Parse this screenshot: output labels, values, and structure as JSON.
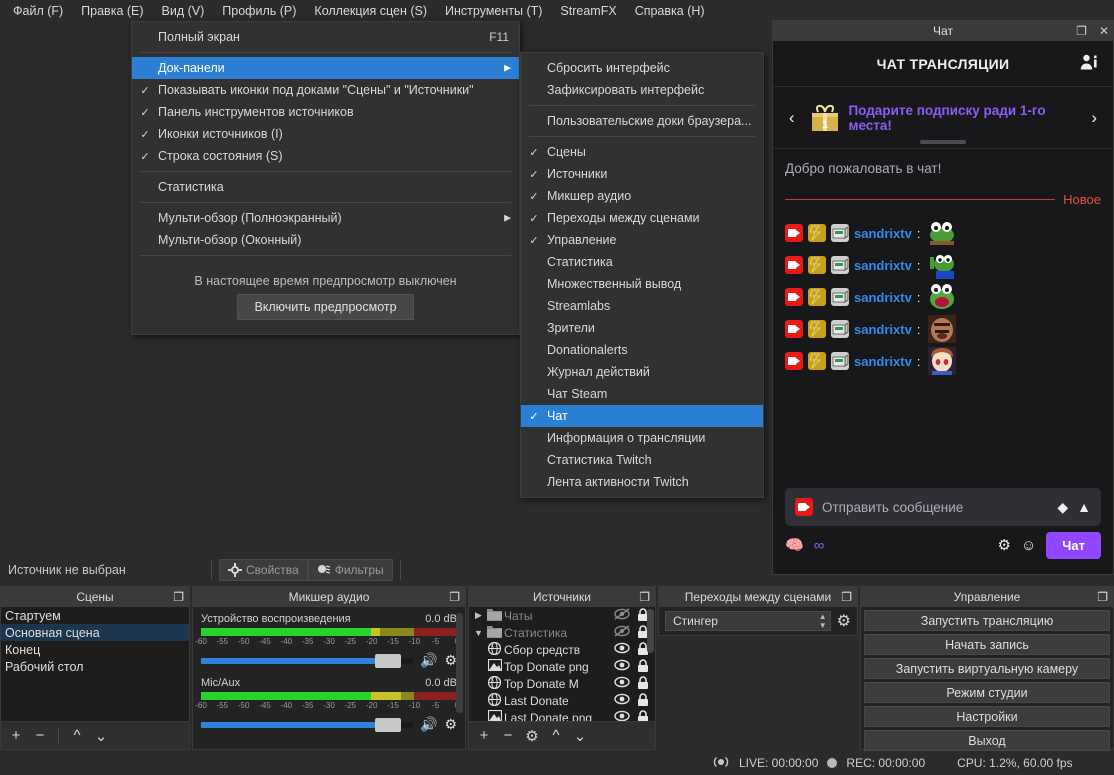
{
  "app": {
    "menubar": [
      {
        "label": "Файл (F)"
      },
      {
        "label": "Правка (E)"
      },
      {
        "label": "Вид (V)"
      },
      {
        "label": "Профиль (P)"
      },
      {
        "label": "Коллекция сцен (S)"
      },
      {
        "label": "Инструменты (T)"
      },
      {
        "label": "StreamFX"
      },
      {
        "label": "Справка (H)"
      }
    ]
  },
  "view_menu": {
    "fullscreen": {
      "label": "Полный экран",
      "shortcut": "F11"
    },
    "docks": {
      "label": "Док-панели",
      "selected": true,
      "has_submenu": true
    },
    "show_icons": {
      "label": "Показывать иконки под доками \"Сцены\" и \"Источники\"",
      "checked": true
    },
    "source_toolbar": {
      "label": "Панель инструментов источников",
      "checked": true
    },
    "source_icons": {
      "label": "Иконки источников (I)",
      "checked": true
    },
    "status_bar": {
      "label": "Строка состояния (S)",
      "checked": true
    },
    "stats": {
      "label": "Статистика"
    },
    "multiview_fullscreen": {
      "label": "Мульти-обзор (Полноэкранный)",
      "has_submenu": true
    },
    "multiview_windowed": {
      "label": "Мульти-обзор (Оконный)"
    },
    "preview_off_text": "В настоящее время предпросмотр выключен",
    "enable_preview_button": "Включить предпросмотр"
  },
  "dock_menu": {
    "items": [
      {
        "label": "Сбросить интерфейс",
        "checked": false
      },
      {
        "label": "Зафиксировать интерфейс",
        "checked": false
      },
      {
        "sep": true
      },
      {
        "label": "Пользовательские доки браузера...",
        "checked": false
      },
      {
        "sep": true
      },
      {
        "label": "Сцены",
        "checked": true
      },
      {
        "label": "Источники",
        "checked": true
      },
      {
        "label": "Микшер аудио",
        "checked": true
      },
      {
        "label": "Переходы между сценами",
        "checked": true
      },
      {
        "label": "Управление",
        "checked": true
      },
      {
        "label": "Статистика",
        "checked": false
      },
      {
        "label": "Множественный вывод",
        "checked": false
      },
      {
        "label": "Streamlabs",
        "checked": false
      },
      {
        "label": "Зрители",
        "checked": false
      },
      {
        "label": "Donationalerts",
        "checked": false
      },
      {
        "label": "Журнал действий",
        "checked": false
      },
      {
        "label": "Чат Steam",
        "checked": false
      },
      {
        "label": "Чат",
        "checked": true,
        "selected": true
      },
      {
        "label": "Информация о трансляции",
        "checked": false
      },
      {
        "label": "Статистика Twitch",
        "checked": false
      },
      {
        "label": "Лента активности Twitch",
        "checked": false
      }
    ]
  },
  "chat_dock": {
    "title": "Чат",
    "header_title": "ЧАТ ТРАНСЛЯЦИИ",
    "promo_text": "Подарите подписку ради 1-го места!",
    "promo_gift_number": "1",
    "welcome": "Добро пожаловать в чат!",
    "new_divider_label": "Новое",
    "messages": [
      {
        "user": "sandrixtv",
        "colon": ":",
        "emote": "pepe-dance"
      },
      {
        "user": "sandrixtv",
        "colon": ":",
        "emote": "pepe-jam"
      },
      {
        "user": "sandrixtv",
        "colon": ":",
        "emote": "pepe-laugh"
      },
      {
        "user": "sandrixtv",
        "colon": ":",
        "emote": "man-face"
      },
      {
        "user": "sandrixtv",
        "colon": ":",
        "emote": "anime-girl"
      }
    ],
    "input_placeholder": "Отправить сообщение",
    "send_button": "Чат",
    "colors": {
      "accent": "#9147ff",
      "username": "#2f8ae8",
      "promo": "#8c5cf6",
      "new": "#e0523f"
    }
  },
  "source_toolbar": {
    "no_source_label": "Источник не выбран",
    "properties_button": "Свойства",
    "filters_button": "Фильтры"
  },
  "scenes_panel": {
    "title": "Сцены",
    "items": [
      {
        "label": "Стартуем",
        "selected": false
      },
      {
        "label": "Основная сцена",
        "selected": true
      },
      {
        "label": "Конец",
        "selected": false
      },
      {
        "label": "Рабочий стол",
        "selected": false
      }
    ],
    "toolbar": [
      "add",
      "remove",
      "move-up",
      "move-down"
    ]
  },
  "mixer_panel": {
    "title": "Микшер аудио",
    "channels": [
      {
        "name": "Mic/Aux",
        "db": "0.0 dB",
        "level_pct": 78,
        "volume_pct": 88
      },
      {
        "name": "Устройство воспроизведения",
        "db": "0.0 dB",
        "level_pct": 70,
        "volume_pct": 88
      }
    ],
    "tick_labels": [
      "-60",
      "-55",
      "-50",
      "-45",
      "-40",
      "-35",
      "-30",
      "-25",
      "-20",
      "-15",
      "-10",
      "-5",
      "0"
    ]
  },
  "sources_panel": {
    "title": "Источники",
    "items": [
      {
        "label": "Чаты",
        "icon": "folder-icon",
        "expand": "collapsed",
        "visible": false,
        "locked": true,
        "dim": true
      },
      {
        "label": "Статистика",
        "icon": "folder-icon",
        "expand": "expanded",
        "visible": false,
        "locked": true,
        "dim": true
      },
      {
        "label": "Сбор средств",
        "icon": "browser-icon",
        "visible": true,
        "locked": true
      },
      {
        "label": "Top Donate png",
        "icon": "image-icon",
        "visible": true,
        "locked": true
      },
      {
        "label": "Top Donate M",
        "icon": "browser-icon",
        "visible": true,
        "locked": true
      },
      {
        "label": "Last Donate",
        "icon": "browser-icon",
        "visible": true,
        "locked": true
      },
      {
        "label": "Last Donate png",
        "icon": "image-icon",
        "visible": true,
        "locked": true
      }
    ],
    "toolbar": [
      "add",
      "remove",
      "properties",
      "move-up",
      "move-down"
    ]
  },
  "transitions_panel": {
    "title": "Переходы между сценами",
    "selected_transition": "Стингер"
  },
  "controls_panel": {
    "title": "Управление",
    "buttons": [
      "Запустить трансляцию",
      "Начать запись",
      "Запустить виртуальную камеру",
      "Режим студии",
      "Настройки",
      "Выход"
    ]
  },
  "status_bar": {
    "live_label": "LIVE: 00:00:00",
    "rec_label": "REC: 00:00:00",
    "cpu_label": "CPU: 1.2%, 60.00 fps"
  }
}
